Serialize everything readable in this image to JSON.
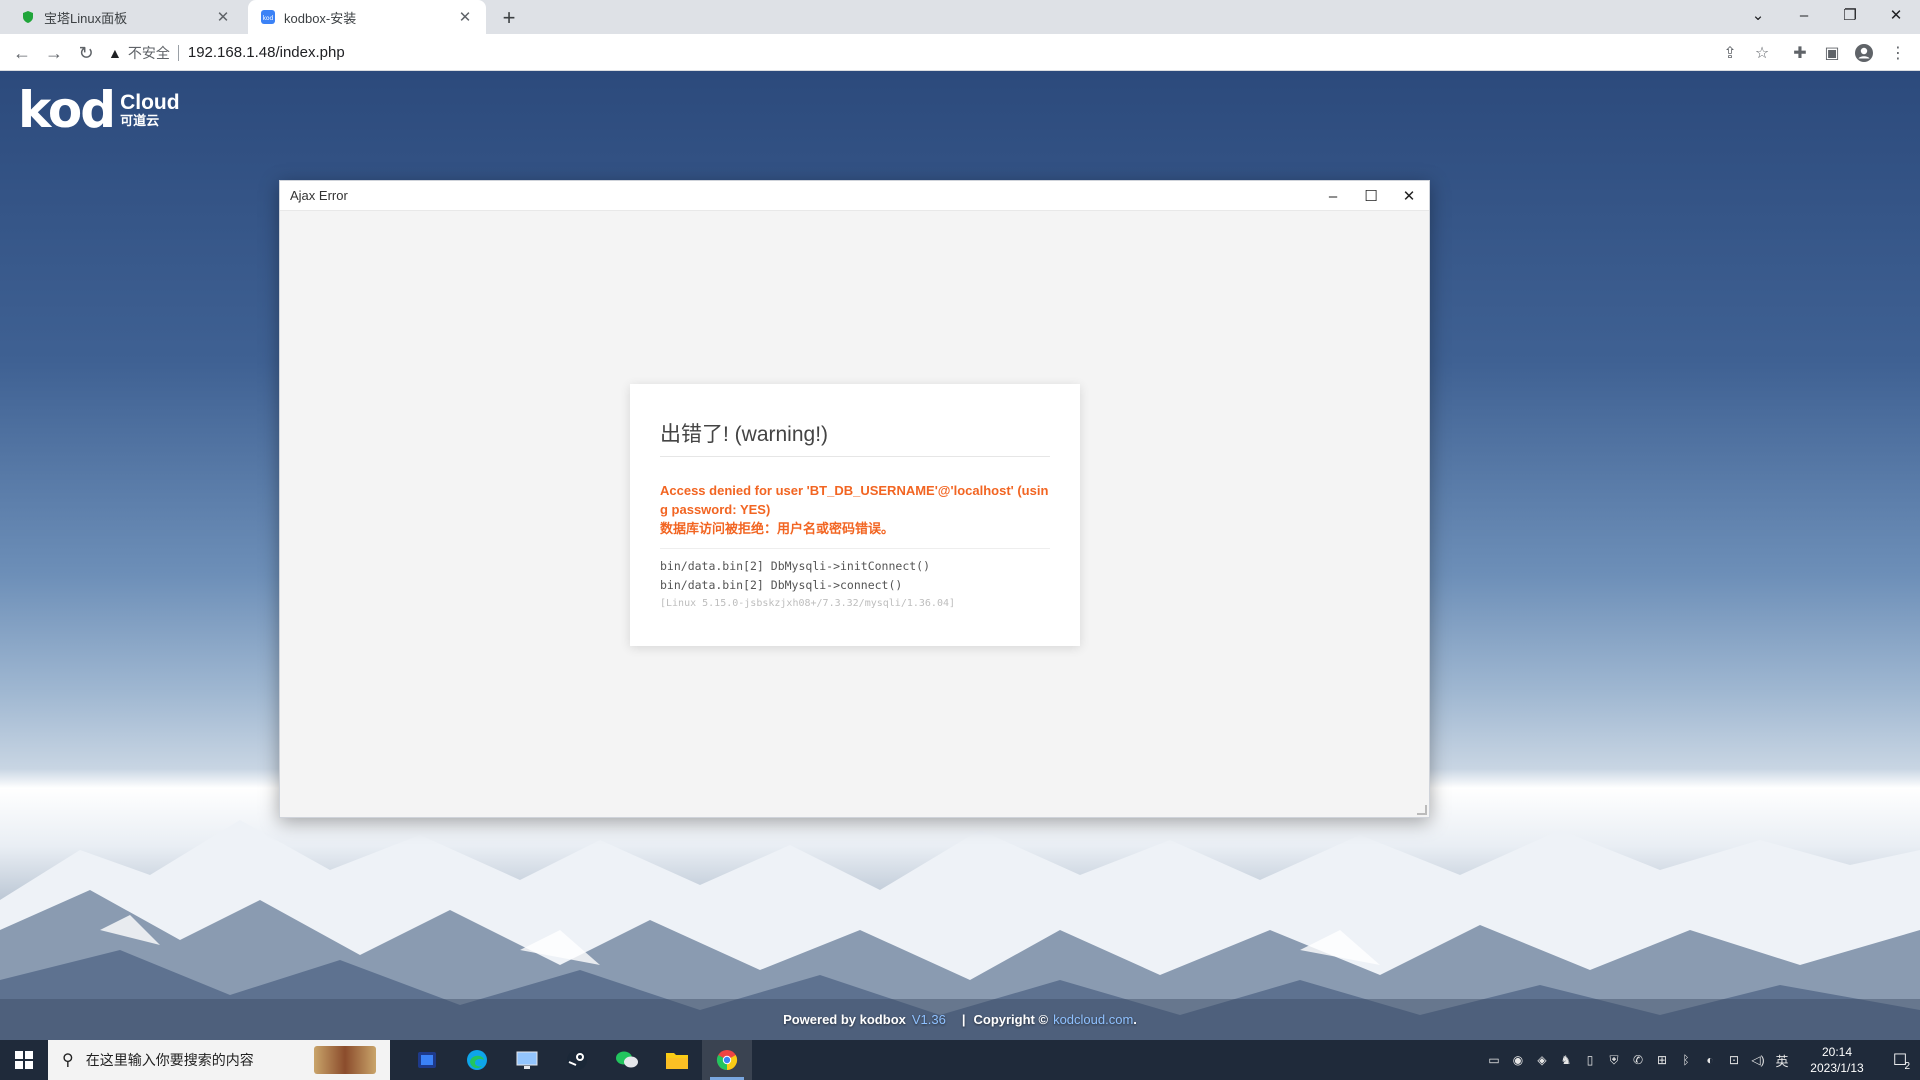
{
  "browser": {
    "tabs": [
      {
        "title": "宝塔Linux面板",
        "active": false
      },
      {
        "title": "kodbox-安装",
        "active": true
      }
    ],
    "address": {
      "security_label": "不安全",
      "url": "192.168.1.48/index.php"
    }
  },
  "page": {
    "logo": {
      "mark": "kod",
      "cloud": "Cloud",
      "cn": "可道云"
    },
    "footer": {
      "powered": "Powered by kodbox",
      "version": "V1.36",
      "separator": "|",
      "copyright": "Copyright ©",
      "link": "kodcloud.com",
      "dot": "."
    }
  },
  "dialog": {
    "title": "Ajax Error",
    "heading": "出错了! (warning!)",
    "error_en": "Access denied for user 'BT_DB_USERNAME'@'localhost' (using password: YES)",
    "error_cn": "数据库访问被拒绝：用户名或密码错误。",
    "trace": [
      "bin/data.bin[2] DbMysqli->initConnect()",
      "bin/data.bin[2] DbMysqli->connect()"
    ],
    "env": "[Linux 5.15.0-jsbskzjxh08+/7.3.32/mysqli/1.36.04]"
  },
  "taskbar": {
    "search_placeholder": "在这里输入你要搜索的内容",
    "ime": "英",
    "time": "20:14",
    "date": "2023/1/13",
    "notifications": "2"
  }
}
